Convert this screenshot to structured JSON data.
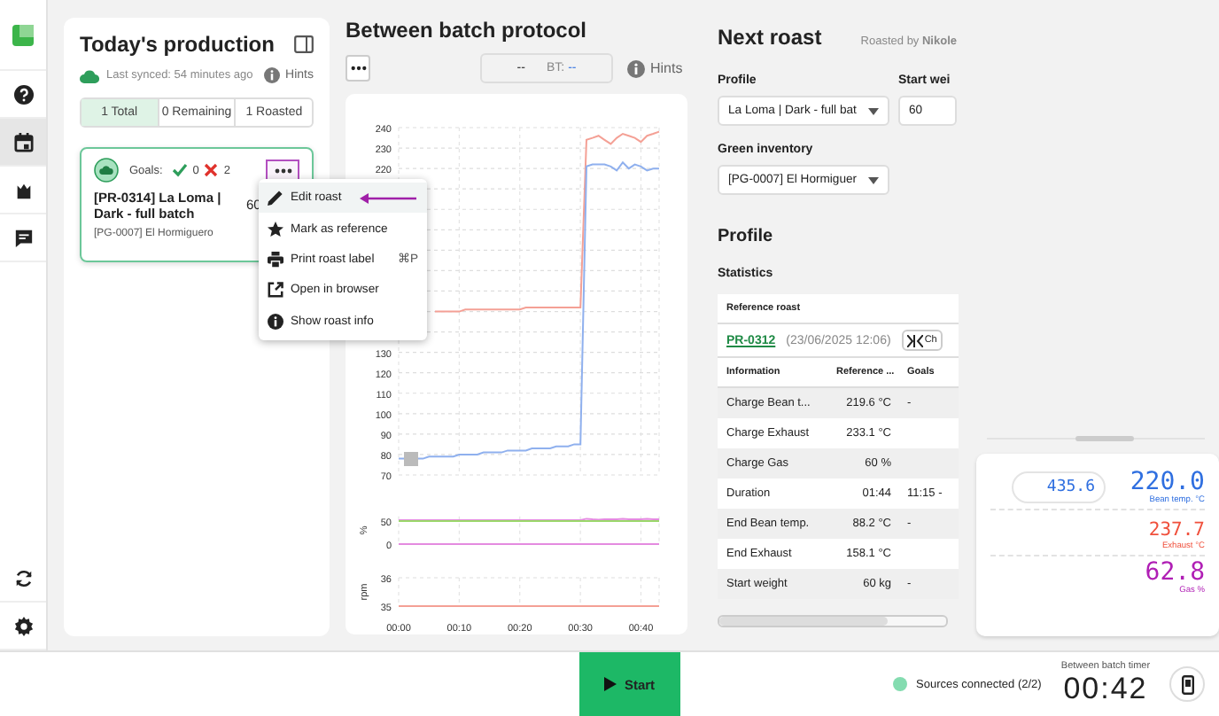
{
  "rail": [
    {
      "kind": "logo",
      "selected": false
    },
    {
      "kind": "help",
      "selected": false
    },
    {
      "kind": "calendar",
      "selected": true
    },
    {
      "kind": "roaster",
      "selected": false
    },
    {
      "kind": "chat",
      "selected": false
    },
    {
      "kind": "sync",
      "selected": false
    },
    {
      "kind": "settings",
      "selected": false
    }
  ],
  "production": {
    "title": "Today's production",
    "synced": "Last synced: 54 minutes ago",
    "hints": "Hints",
    "tabs": [
      {
        "label": "1 Total",
        "selected": true
      },
      {
        "label": "0 Remaining",
        "selected": false
      },
      {
        "label": "1 Roasted",
        "selected": false
      }
    ],
    "card": {
      "goals_label": "Goals:",
      "goals_met": "0",
      "goals_missed": "2",
      "title": "[PR-0314] La Loma | Dark - full batch",
      "weight": "60",
      "green": "[PG-0007] El Hormiguero",
      "more_highlighted": true
    },
    "menu": [
      {
        "kind": "edit",
        "label": "Edit roast",
        "selected": true,
        "arrow": true
      },
      {
        "kind": "star",
        "label": "Mark as reference",
        "selected": false,
        "arrow": false
      },
      {
        "kind": "print",
        "label": "Print roast label",
        "shortcut": "⌘P",
        "selected": false,
        "arrow": false
      },
      {
        "kind": "open",
        "label": "Open in browser",
        "selected": false,
        "arrow": false
      },
      {
        "kind": "info",
        "label": "Show roast info",
        "selected": false,
        "arrow": false
      }
    ]
  },
  "protocol": {
    "title": "Between batch protocol",
    "display_value": "--",
    "bt_label": "BT:",
    "bt_value": "--",
    "hints": "Hints",
    "charts": [
      {
        "chart_data": {
          "type": "line",
          "grid": true,
          "x": [
            0,
            1,
            2,
            3,
            4,
            5,
            6,
            7,
            8,
            9,
            10,
            11,
            12,
            13,
            14,
            15,
            16,
            17,
            18,
            19,
            20,
            21,
            22,
            23,
            24,
            25,
            26,
            27,
            28,
            29,
            30,
            31,
            32,
            33,
            34,
            35,
            36,
            37,
            38,
            39,
            40,
            41,
            42,
            43
          ],
          "xlim": [
            0,
            43
          ],
          "ylim": [
            70,
            240
          ],
          "yticks": [
            70,
            80,
            90,
            100,
            110,
            120,
            130,
            220,
            230,
            240
          ],
          "series": [
            {
              "color": "#f4a095",
              "values": [
                null,
                null,
                null,
                null,
                null,
                null,
                150,
                150,
                150,
                150,
                150,
                151,
                151,
                151,
                151,
                151,
                151,
                151,
                151,
                151,
                151,
                152,
                152,
                152,
                152,
                152,
                152,
                152,
                152,
                152,
                152,
                234,
                235,
                236,
                234,
                232,
                235,
                237,
                236,
                235,
                233,
                236,
                237,
                238
              ]
            },
            {
              "color": "#8fb0ee",
              "values": [
                78,
                78,
                78,
                78,
                78,
                79,
                79,
                79,
                79,
                79,
                80,
                80,
                80,
                80,
                81,
                81,
                81,
                81,
                82,
                82,
                82,
                82,
                83,
                83,
                83,
                83,
                84,
                84,
                84,
                85,
                85,
                221,
                222,
                222,
                222,
                221,
                219,
                223,
                220,
                222,
                221,
                219,
                220,
                220
              ]
            }
          ]
        }
      },
      {
        "chart_data": {
          "type": "line",
          "grid": true,
          "ylabel": "%",
          "x": [
            0,
            1,
            2,
            3,
            4,
            5,
            6,
            7,
            8,
            9,
            10,
            11,
            12,
            13,
            14,
            15,
            16,
            17,
            18,
            19,
            20,
            21,
            22,
            23,
            24,
            25,
            26,
            27,
            28,
            29,
            30,
            31,
            32,
            33,
            34,
            35,
            36,
            37,
            38,
            39,
            40,
            41,
            42,
            43
          ],
          "xlim": [
            0,
            43
          ],
          "ylim": [
            0,
            60
          ],
          "yticks": [
            0,
            50
          ],
          "series": [
            {
              "color": "#e48be0",
              "values": [
                52,
                52,
                52,
                52,
                52,
                52,
                52,
                52,
                52,
                52,
                52,
                52,
                52,
                52,
                52,
                52,
                52,
                52,
                52,
                52,
                52,
                52,
                52,
                52,
                52,
                52,
                52,
                52,
                52,
                52,
                52,
                55,
                54,
                53,
                54,
                54,
                54,
                55,
                54,
                54,
                54,
                55,
                54,
                54
              ]
            },
            {
              "color": "#9ad86a",
              "values": [
                50,
                50,
                50,
                50,
                50,
                50,
                50,
                50,
                50,
                50,
                50,
                50,
                50,
                50,
                50,
                50,
                50,
                50,
                50,
                50,
                50,
                50,
                50,
                50,
                50,
                50,
                50,
                50,
                50,
                50,
                50,
                50,
                50,
                50,
                50,
                50,
                50,
                50,
                50,
                50,
                50,
                50,
                50,
                50
              ]
            },
            {
              "color": "#e48be0",
              "values": [
                0,
                0,
                0,
                0,
                0,
                0,
                0,
                0,
                0,
                0,
                0,
                0,
                0,
                0,
                0,
                0,
                0,
                0,
                0,
                0,
                0,
                0,
                0,
                0,
                0,
                0,
                0,
                0,
                0,
                0,
                0,
                0,
                0,
                0,
                0,
                0,
                0,
                0,
                0,
                0,
                0,
                0,
                0,
                0
              ]
            }
          ]
        }
      },
      {
        "chart_data": {
          "type": "line",
          "grid": true,
          "ylabel": "rpm",
          "x": [
            0,
            43
          ],
          "xlim": [
            0,
            43
          ],
          "ylim": [
            35,
            36
          ],
          "yticks": [
            35,
            36
          ],
          "xticks": [
            {
              "value": 0,
              "label": "00:00"
            },
            {
              "value": 10,
              "label": "00:10"
            },
            {
              "value": 20,
              "label": "00:20"
            },
            {
              "value": 30,
              "label": "00:30"
            },
            {
              "value": 40,
              "label": "00:40"
            }
          ],
          "series": [
            {
              "color": "#f4a095",
              "values": [
                35,
                35
              ]
            }
          ]
        }
      }
    ]
  },
  "next_roast": {
    "title": "Next roast",
    "roasted_by": "Roasted by **Nikole**",
    "profile_label": "Profile",
    "profile_value": "La Loma | Dark - full bat",
    "weight_label": "Start wei",
    "weight_value": "60",
    "green_label": "Green inventory",
    "green_value": "[PG-0007] El Hormiguer",
    "profile_heading": "Profile",
    "statistics": "Statistics",
    "reference_label": "Reference roast",
    "reference_link": "PR-0312",
    "reference_date": "(23/06/2025 12:06)",
    "compare_button": "Ch",
    "columns": [
      "Information",
      "Reference ...",
      "Goals"
    ],
    "rows": [
      [
        "Charge Bean t...",
        "219.6 °C",
        "-"
      ],
      [
        "Charge Exhaust",
        "233.1 °C",
        ""
      ],
      [
        "Charge Gas",
        "60 %",
        ""
      ],
      [
        "Duration",
        "01:44",
        "11:15 -"
      ],
      [
        "End Bean temp.",
        "88.2 °C",
        "-"
      ],
      [
        "End Exhaust",
        "158.1 °C",
        ""
      ],
      [
        "Start weight",
        "60 kg",
        "-"
      ]
    ]
  },
  "readouts": {
    "side_value": "435.6",
    "items": [
      {
        "value": "220.0",
        "label": "Bean temp. °C",
        "color": "#2f6fe0"
      },
      {
        "value": "237.7",
        "label": "Exhaust °C",
        "color": "#f0503c"
      },
      {
        "value": "62.8",
        "label": "Gas %",
        "color": "#b01fb5"
      }
    ]
  },
  "bottom": {
    "start": "Start",
    "sources": "Sources connected (2/2)",
    "sources_ok": true,
    "timer_label": "Between batch timer",
    "timer": "00:42"
  }
}
